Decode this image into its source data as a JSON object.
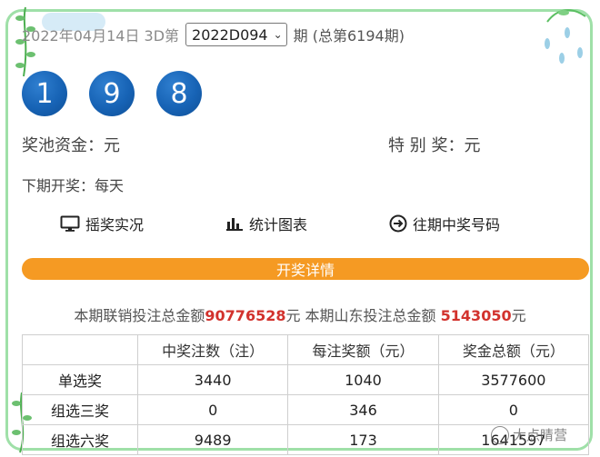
{
  "header": {
    "date_text": "2022年04月14日 3D第",
    "issue_selected": "2022D094",
    "issue_suffix": "期 (总第6194期)"
  },
  "draw_numbers": [
    "1",
    "9",
    "8"
  ],
  "info": {
    "pool_label": "奖池资金：",
    "pool_unit": "元",
    "special_label": "特 别 奖：",
    "special_unit": "元",
    "next_draw": "下期开奖：每天"
  },
  "links": {
    "live": "摇奖实况",
    "chart": "统计图表",
    "history": "往期中奖号码"
  },
  "detail_button": "开奖详情",
  "sales": {
    "prefix": "本期联销投注总金额",
    "union_amount": "90776528",
    "mid": "元 本期山东投注总金额 ",
    "shandong_amount": "5143050",
    "suffix": "元"
  },
  "table": {
    "headers": [
      "",
      "中奖注数（注）",
      "每注奖额（元）",
      "奖金总额（元）"
    ],
    "rows": [
      [
        "单选奖",
        "3440",
        "1040",
        "3577600"
      ],
      [
        "组选三奖",
        "0",
        "346",
        "0"
      ],
      [
        "组选六奖",
        "9489",
        "173",
        "1641597"
      ]
    ]
  },
  "watermark": "大点睛营",
  "colors": {
    "ball": "#1763b5",
    "detail_bar": "#f59a23",
    "amount": "#d2322d",
    "frame": "#9fe0a8"
  },
  "icons": {
    "live": "monitor-icon",
    "chart": "bar-chart-icon",
    "history": "arrow-circle-icon"
  }
}
